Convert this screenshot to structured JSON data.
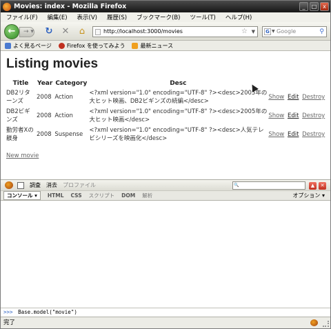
{
  "window": {
    "title": "Movies: index - Mozilla Firefox",
    "btn_min": "_",
    "btn_max": "□",
    "btn_close": "x"
  },
  "menu": [
    "ファイル(F)",
    "編集(E)",
    "表示(V)",
    "履歴(S)",
    "ブックマーク(B)",
    "ツール(T)",
    "ヘルプ(H)"
  ],
  "nav": {
    "back_icon": "back-arrow-icon",
    "forward_icon": "forward-arrow-icon",
    "url": "http://localhost:3000/movies",
    "search_placeholder": "Google"
  },
  "bookmarks": [
    {
      "label": "よく見るページ",
      "color": "#4a7ad0"
    },
    {
      "label": "Firefox を使ってみよう",
      "color": "#c03020"
    },
    {
      "label": "最新ニュース",
      "color": "#f0a020"
    }
  ],
  "page": {
    "heading": "Listing movies",
    "columns": [
      "Title",
      "Year",
      "Category",
      "Desc"
    ],
    "rows": [
      {
        "title": "DB2リターンズ",
        "year": "2008",
        "category": "Action",
        "desc": "<?xml version=\"1.0\" encoding=\"UTF-8\" ?><desc>2005年の大ヒット映画、DB2ビギンズの続編</desc>"
      },
      {
        "title": "DB2ビギンズ",
        "year": "2008",
        "category": "Action",
        "desc": "<?xml version=\"1.0\" encoding=\"UTF-8\" ?><desc>2005年の大ヒット映画</desc>"
      },
      {
        "title": "勤労者Xの躾身",
        "year": "2008",
        "category": "Suspense",
        "desc": "<?xml version=\"1.0\" encoding=\"UTF-8\" ?><desc>人気テレビシリーズを映画化</desc>"
      }
    ],
    "actions": {
      "show": "Show",
      "edit": "Edit",
      "destroy": "Destroy"
    },
    "new_link": "New movie"
  },
  "firebug": {
    "menu": [
      "調査",
      "消去",
      "プロファイル"
    ],
    "tabs": [
      "コンソール ▾",
      "HTML",
      "CSS",
      "スクリプト",
      "DOM",
      "解析"
    ],
    "options": "オプション ▾",
    "search_value": "",
    "command": "Base.model(\"movie\")"
  },
  "status": {
    "text": "完了"
  }
}
